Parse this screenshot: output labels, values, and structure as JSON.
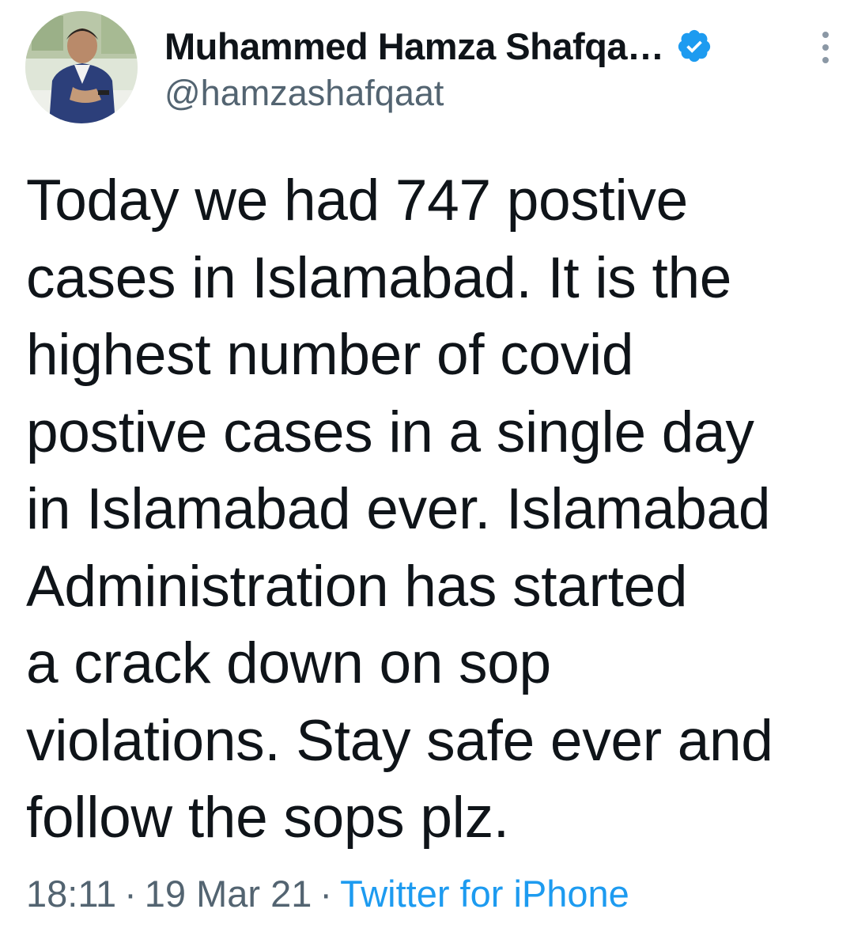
{
  "author": {
    "display_name": "Muhammed Hamza Shafqa…",
    "handle": "@hamzashafqaat",
    "verified": true
  },
  "tweet": {
    "lines": [
      "Today we had 747 postive",
      "cases in Islamabad. It is the",
      "highest number of covid",
      "postive cases in a single day",
      "in Islamabad ever. Islamabad",
      "Administration has started",
      "a crack down on sop",
      "violations. Stay safe ever and",
      "follow the sops plz."
    ],
    "time": "18:11",
    "separator": "·",
    "date": "19 Mar 21",
    "source": "Twitter for iPhone"
  },
  "colors": {
    "text": "#0f1419",
    "secondary": "#536471",
    "accent": "#1d9bf0"
  },
  "icons": {
    "verified": "verified-badge-icon",
    "more": "more-vertical-icon"
  }
}
